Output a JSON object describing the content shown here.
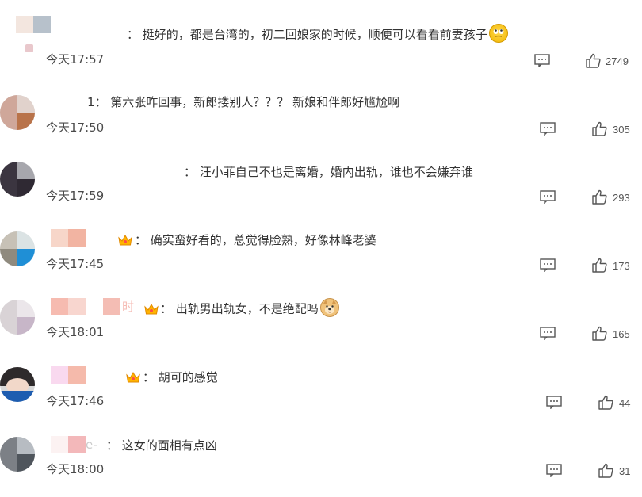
{
  "comments": [
    {
      "text": "： 挺好的，都是台湾的，初二回娘家的时候，顺便可以看看前妻孩子",
      "time": "今天17:57",
      "likes": "2749",
      "emoji": "rolling-eyes-emoji"
    },
    {
      "text": "1： 第六张咋回事，新郎搂别人？？？ 新娘和伴郎好尴尬啊",
      "time": "今天17:50",
      "likes": "305"
    },
    {
      "text": "： 汪小菲自己不也是离婚，婚内出轨，谁也不会嫌弃谁",
      "time": "今天17:59",
      "likes": "293"
    },
    {
      "text": "： 确实蛮好看的，总觉得脸熟，好像林峰老婆",
      "time": "今天17:45",
      "likes": "173"
    },
    {
      "name_tail": "时",
      "text": "： 出轨男出轨女，不是绝配吗",
      "time": "今天18:01",
      "likes": "165",
      "emoji": "doge-emoji"
    },
    {
      "text": "： 胡可的感觉",
      "time": "今天17:46",
      "likes": "44"
    },
    {
      "name_tail": "e-",
      "text": "： 这女的面相有点凶",
      "time": "今天18:00",
      "likes": "31"
    }
  ]
}
